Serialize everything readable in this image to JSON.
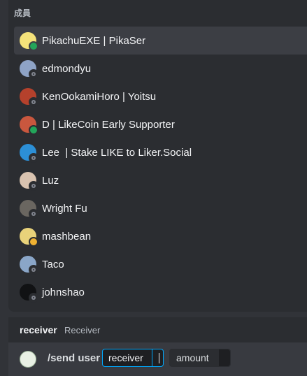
{
  "popup": {
    "section_title": "成員",
    "members": [
      {
        "name": "PikachuEXE | PikaSer",
        "status": "online",
        "avatar_color": "#f4e27a",
        "selected": true
      },
      {
        "name": "edmondyu",
        "status": "offline",
        "avatar_color": "#8ea3c6"
      },
      {
        "name": "KenOokamiHoro | Yoitsu",
        "status": "offline",
        "avatar_color": "#b5412c"
      },
      {
        "name": "D | LikeCoin Early Supporter",
        "status": "online",
        "avatar_color": "#c9573e"
      },
      {
        "name": "Lee  | Stake LIKE to Liker.Social",
        "status": "offline",
        "avatar_color": "#2c8fd6"
      },
      {
        "name": "Luz",
        "status": "offline",
        "avatar_color": "#d9c3b0"
      },
      {
        "name": "Wright Fu",
        "status": "offline",
        "avatar_color": "#6a6660"
      },
      {
        "name": "mashbean",
        "status": "idle",
        "avatar_color": "#e8d27a"
      },
      {
        "name": "Taco",
        "status": "offline",
        "avatar_color": "#8aa6c8"
      },
      {
        "name": "johnshao",
        "status": "offline",
        "avatar_color": "#111214"
      }
    ]
  },
  "option_hint": {
    "name": "receiver",
    "description": "Receiver"
  },
  "input": {
    "command": "/send user",
    "options": [
      {
        "label": "receiver",
        "active": true
      },
      {
        "label": "amount",
        "active": false
      }
    ]
  }
}
